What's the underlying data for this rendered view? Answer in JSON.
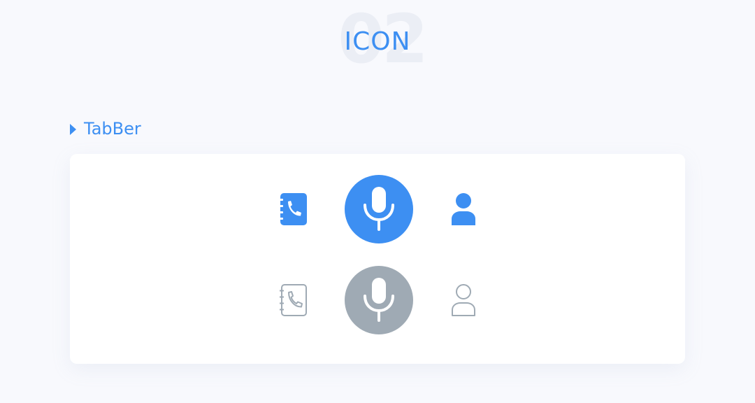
{
  "header": {
    "background_number": "02",
    "title": "ICON"
  },
  "section": {
    "label": "TabBer"
  },
  "colors": {
    "accent": "#3d8ff2",
    "inactive": "#9faab4",
    "card_background": "#ffffff",
    "page_background": "#f8f9fd"
  },
  "icons": {
    "active_row": [
      "contacts-book-icon",
      "microphone-icon",
      "person-icon"
    ],
    "inactive_row": [
      "contacts-book-icon",
      "microphone-icon",
      "person-icon"
    ]
  }
}
